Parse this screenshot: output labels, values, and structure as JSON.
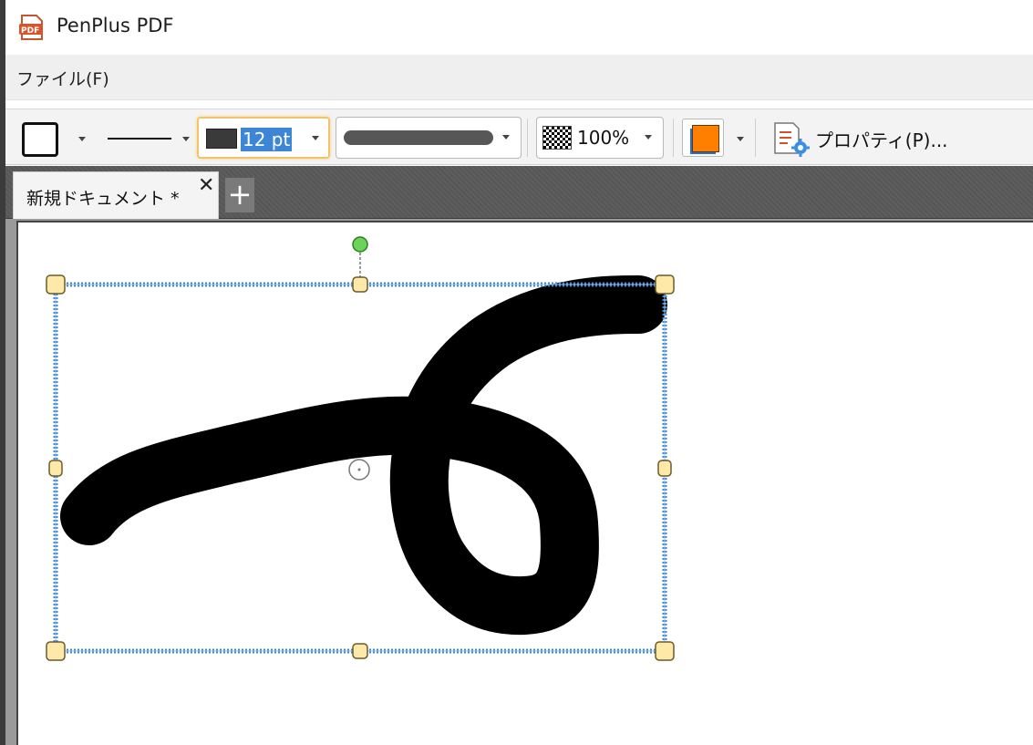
{
  "app": {
    "title": "PenPlus PDF",
    "icon": "pdf-app-icon"
  },
  "menu": {
    "items": [
      {
        "label": "ファイル(F)"
      }
    ]
  },
  "toolbar": {
    "shape": {
      "icon": "rectangle-shape-icon"
    },
    "line_style": {
      "icon": "solid-line-icon"
    },
    "line_width": {
      "value": "12 pt"
    },
    "stroke_style": {
      "icon": "thick-rounded-stroke-icon"
    },
    "opacity": {
      "value": "100%"
    },
    "color": {
      "value": "#ff7f00",
      "secondary": "#1e6fe0"
    },
    "properties": {
      "label": "プロパティ(P)...",
      "icon": "properties-gear-icon"
    }
  },
  "tabs": [
    {
      "label": "新規ドキュメント *",
      "close": "✕"
    }
  ],
  "tab_add": {
    "label": "+"
  },
  "colors": {
    "selection": "#3d86d6",
    "handle_fill": "#ffe9a8",
    "rotate_handle": "#6cd35a",
    "ink": "#000000"
  }
}
